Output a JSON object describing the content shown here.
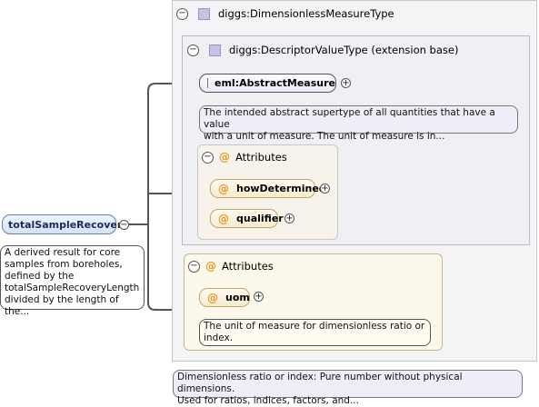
{
  "root": {
    "name": "totalSampleRecovery",
    "doc": [
      "A derived result for core",
      "samples from boreholes,",
      "defined by the",
      "totalSampleRecoveryLength",
      "divided by the length of the..."
    ]
  },
  "type_panel": {
    "title": "diggs:DimensionlessMeasureType",
    "doc": [
      "Dimensionless ratio or index: Pure number without physical dimensions.",
      "Used for ratios, indices, factors, and..."
    ]
  },
  "base_panel": {
    "title": "diggs:DescriptorValueType (extension base)",
    "abstract_element": {
      "name": "eml:AbstractMeasure",
      "doc": [
        "The intended abstract supertype of all quantities that have a value",
        "with a unit of measure. The unit of measure is in..."
      ]
    },
    "attributes": {
      "title": "Attributes",
      "items": [
        "howDetermined",
        "qualifier"
      ]
    }
  },
  "own_attributes": {
    "title": "Attributes",
    "uom": {
      "name": "uom",
      "doc": [
        "The unit of measure for dimensionless ratio or",
        "index."
      ]
    }
  },
  "colors": {
    "element_border": "#6c7fa8",
    "attribute_at": "#e39a28",
    "type_icon": "#c8c0e6"
  }
}
